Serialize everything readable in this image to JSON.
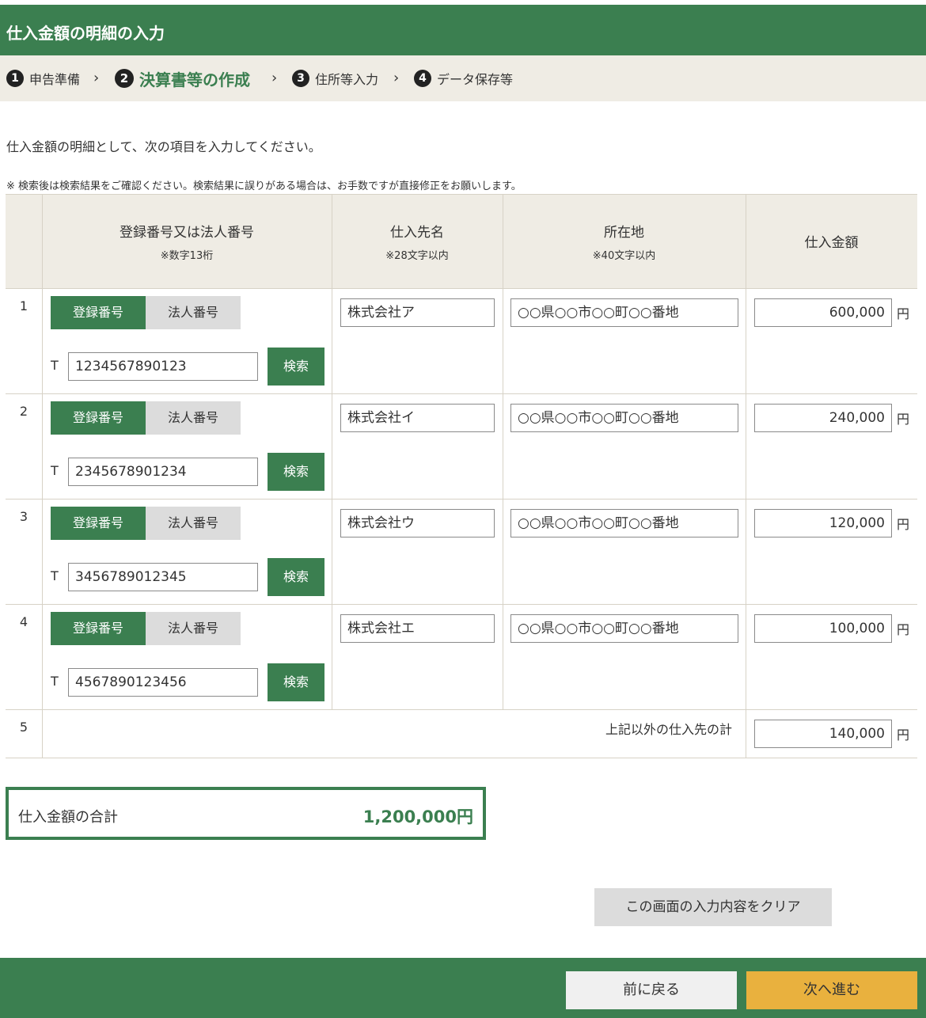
{
  "header": {
    "title": "仕入金額の明細の入力"
  },
  "steps": [
    {
      "num": "1",
      "label": "申告準備",
      "active": false
    },
    {
      "num": "2",
      "label": "決算書等の作成",
      "active": true
    },
    {
      "num": "3",
      "label": "住所等入力",
      "active": false
    },
    {
      "num": "4",
      "label": "データ保存等",
      "active": false
    }
  ],
  "step_separator": "›",
  "intro": "仕入金額の明細として、次の項目を入力してください。",
  "note": "※ 検索後は検索結果をご確認ください。検索結果に誤りがある場合は、お手数ですが直接修正をお願いします。",
  "table": {
    "headers": {
      "reg_title": "登録番号又は法人番号",
      "reg_sub": "※数字13桁",
      "name_title": "仕入先名",
      "name_sub": "※28文字以内",
      "addr_title": "所在地",
      "addr_sub": "※40文字以内",
      "amount_title": "仕入金額"
    },
    "toggle_on": "登録番号",
    "toggle_off": "法人番号",
    "t_prefix": "T",
    "search_label": "検索",
    "yen": "円",
    "rows": [
      {
        "no": "1",
        "reg_number": "1234567890123",
        "name": "株式会社ア",
        "address": "○○県○○市○○町○○番地",
        "amount": "600,000"
      },
      {
        "no": "2",
        "reg_number": "2345678901234",
        "name": "株式会社イ",
        "address": "○○県○○市○○町○○番地",
        "amount": "240,000"
      },
      {
        "no": "3",
        "reg_number": "3456789012345",
        "name": "株式会社ウ",
        "address": "○○県○○市○○町○○番地",
        "amount": "120,000"
      },
      {
        "no": "4",
        "reg_number": "4567890123456",
        "name": "株式会社エ",
        "address": "○○県○○市○○町○○番地",
        "amount": "100,000"
      }
    ],
    "other": {
      "no": "5",
      "label": "上記以外の仕入先の計",
      "amount": "140,000"
    }
  },
  "total": {
    "label": "仕入金額の合計",
    "value": "1,200,000円"
  },
  "buttons": {
    "clear": "この画面の入力内容をクリア",
    "back": "前に戻る",
    "next": "次へ進む"
  },
  "colors": {
    "brand_green": "#3b7f50",
    "next_button": "#e9b13e",
    "header_bg": "#efece4"
  }
}
